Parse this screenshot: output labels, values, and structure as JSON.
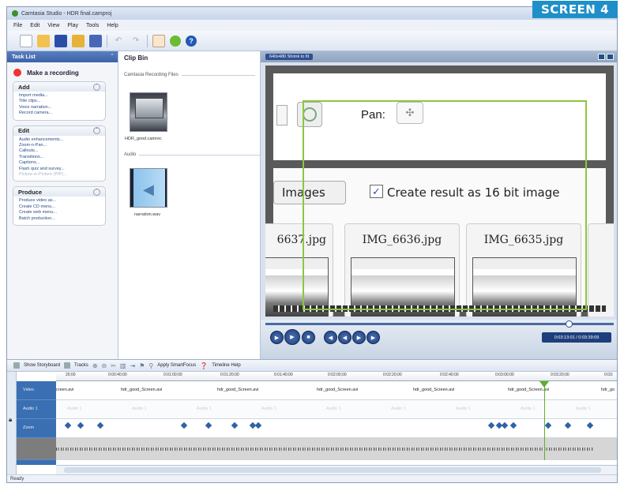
{
  "window": {
    "title": "Camtasia Studio - HDR final.camproj"
  },
  "badge": "SCREEN 4",
  "menu": [
    "File",
    "Edit",
    "View",
    "Play",
    "Tools",
    "Help"
  ],
  "tasklist": {
    "header": "Task List",
    "record_label": "Make a recording",
    "groups": [
      {
        "title": "Add",
        "items": [
          "Import media...",
          "Title clips...",
          "Voice narration...",
          "Record camera..."
        ]
      },
      {
        "title": "Edit",
        "items": [
          "Audio enhancements...",
          "Zoom-n-Pan...",
          "Callouts...",
          "Transitions...",
          "Captions...",
          "Flash quiz and survey...",
          "Picture-in-Picture (PIP)..."
        ]
      },
      {
        "title": "Produce",
        "items": [
          "Produce video as...",
          "Create CD menu...",
          "Create web menu...",
          "Batch production..."
        ]
      }
    ]
  },
  "clipbin": {
    "title": "Clip Bin",
    "recording_section": "Camtasia Recording Files",
    "recording_file": "HDR_good.camrec",
    "audio_section": "Audio",
    "audio_file": "narration.wav"
  },
  "preview": {
    "size_select": "640x480  Shrink to fit",
    "pan_label": "Pan:",
    "pan_glyph": "✣",
    "images_button": "Images",
    "checkbox_label": "Create result as 16 bit image",
    "checkbox_mark": "✓",
    "files": [
      "6637.jpg",
      "IMG_6636.jpg",
      "IMG_6635.jpg",
      ""
    ],
    "progress": 0.87,
    "timecode": "0:03:13:01 / 0:03:39:09"
  },
  "timeline": {
    "toolbar": {
      "storyboard": "Show Storyboard",
      "tracks": "Tracks",
      "smartfocus": "Apply SmartFocus",
      "help": "Timeline Help"
    },
    "ticks": [
      "20;00",
      "0:00:40;00",
      "0:01:00;00",
      "0:01:20;00",
      "0:01:40;00",
      "0:02:00;00",
      "0:02:20;00",
      "0:02:40;00",
      "0:03:00;00",
      "0:03:20;00",
      "0:03:"
    ],
    "track_labels": [
      "Video",
      "Audio 1",
      "Zoom",
      ""
    ],
    "video_clips": [
      "creen.avi",
      "hdr_good_Screen.avi",
      "hdr_good_Screen.avi",
      "hdr_good_Screen.avi",
      "hdr_good_Screen.avi",
      "hdr_good_Screen.avi",
      "hdr_go"
    ],
    "audio_clips": [
      "Audio 1",
      "Audio 1",
      "Audio 1",
      "Audio 1",
      "Audio 1",
      "Audio 1",
      "Audio 1",
      "Audio 1",
      "Audio 1"
    ]
  },
  "status": "Ready"
}
